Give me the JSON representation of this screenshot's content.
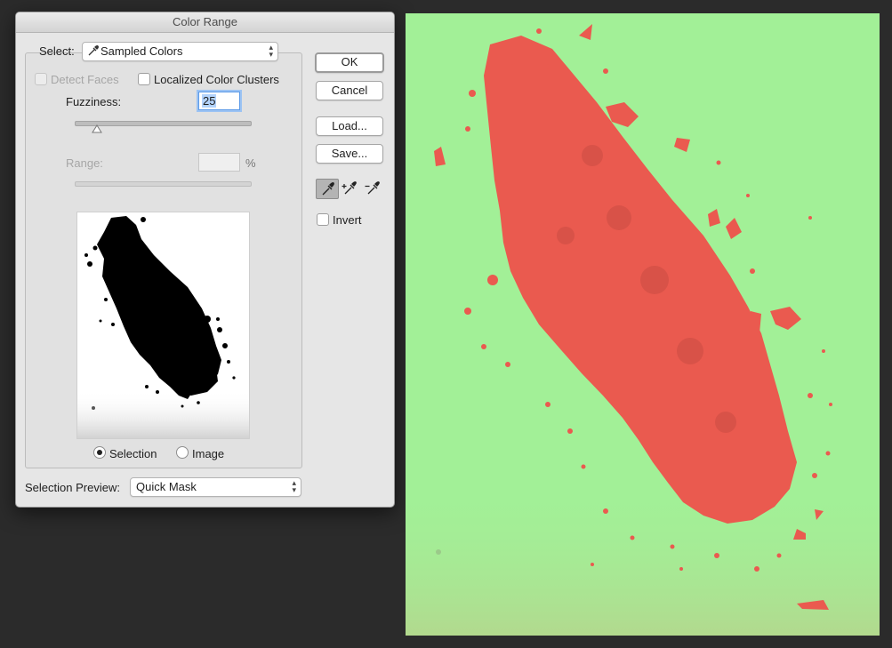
{
  "dialog": {
    "title": "Color Range",
    "select_label": "Select:",
    "select_value": "Sampled Colors",
    "detect_faces_label": "Detect Faces",
    "localized_label": "Localized Color Clusters",
    "fuzziness_label": "Fuzziness:",
    "fuzziness_value": "25",
    "fuzziness_level": 0.125,
    "range_label": "Range:",
    "range_unit": "%",
    "range_value": "",
    "radio_selection_label": "Selection",
    "radio_image_label": "Image",
    "preview_label": "Selection Preview:",
    "preview_value": "Quick Mask",
    "buttons": {
      "ok": "OK",
      "cancel": "Cancel",
      "load": "Load...",
      "save": "Save..."
    },
    "invert_label": "Invert"
  },
  "colors": {
    "canvas_bg": "#a2f097",
    "sample_red": "#ea5a4f"
  }
}
